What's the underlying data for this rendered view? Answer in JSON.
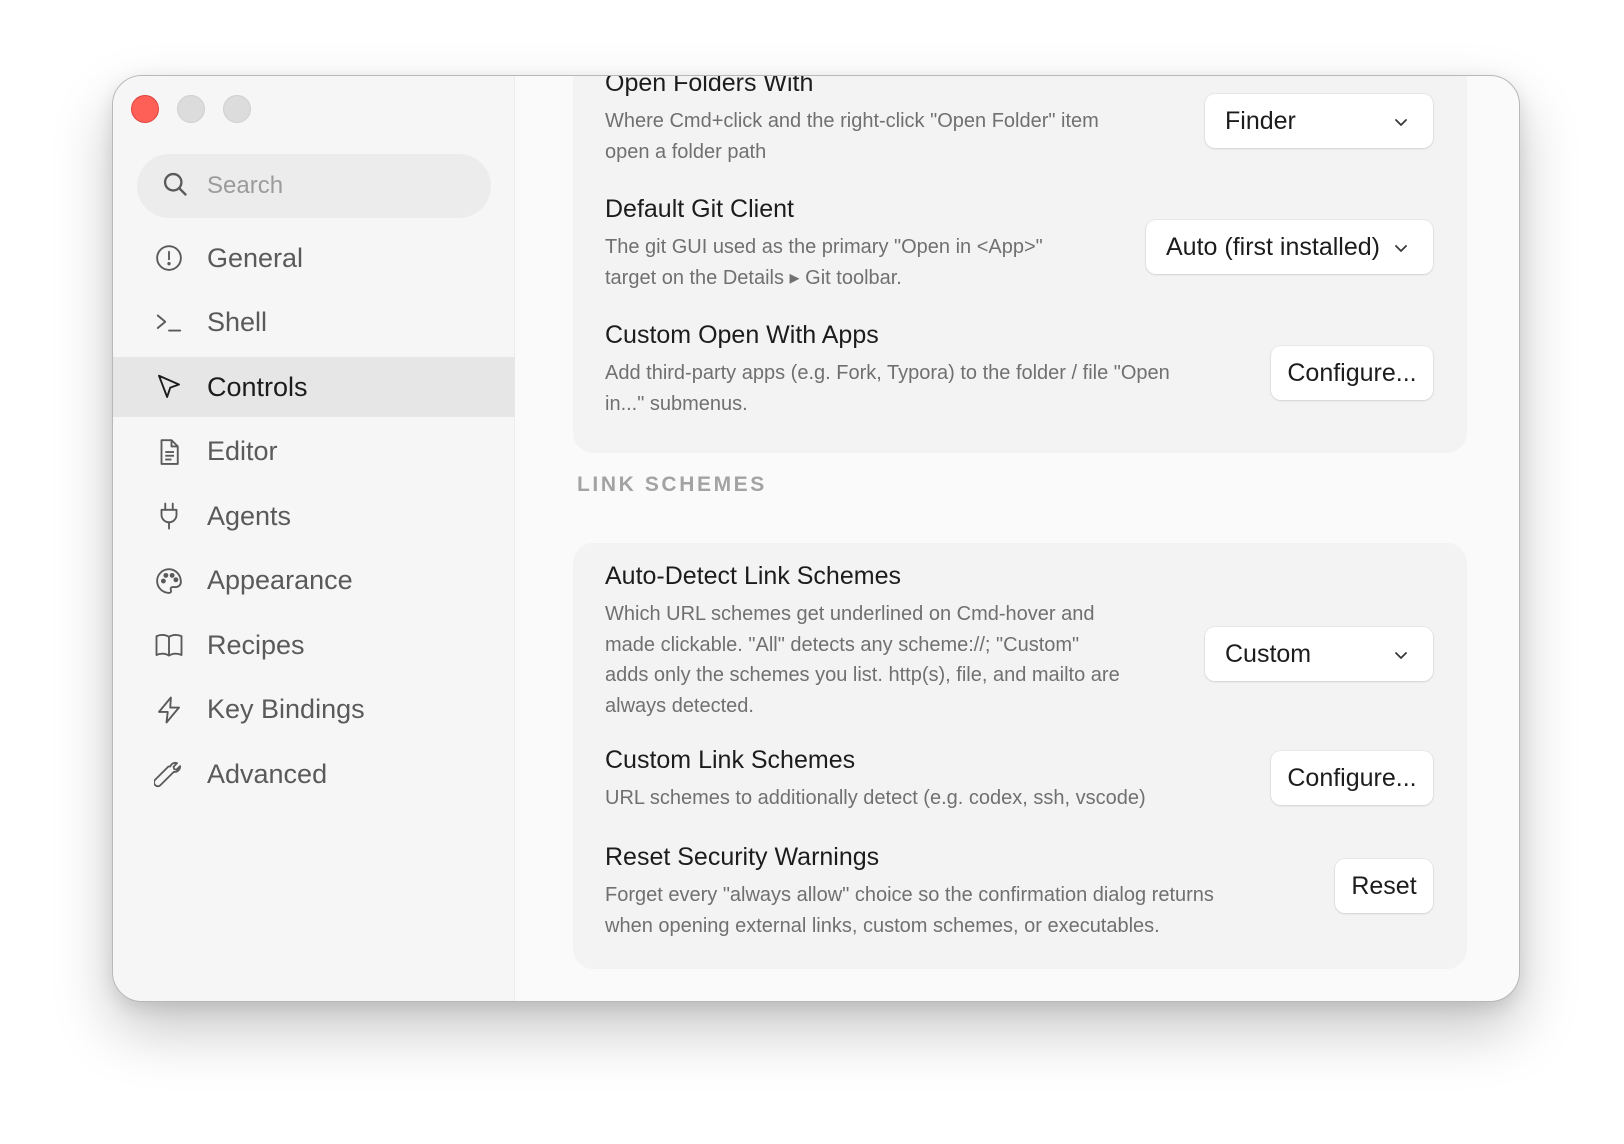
{
  "window": {
    "controls": {
      "close": "close",
      "minimize": "minimize",
      "zoom": "zoom"
    }
  },
  "sidebar": {
    "search": {
      "placeholder": "Search"
    },
    "items": [
      {
        "label": "General",
        "icon": "exclamation-circle-icon",
        "active": false
      },
      {
        "label": "Shell",
        "icon": "terminal-prompt-icon",
        "active": false
      },
      {
        "label": "Controls",
        "icon": "cursor-pointer-icon",
        "active": true
      },
      {
        "label": "Editor",
        "icon": "document-icon",
        "active": false
      },
      {
        "label": "Agents",
        "icon": "plug-icon",
        "active": false
      },
      {
        "label": "Appearance",
        "icon": "palette-icon",
        "active": false
      },
      {
        "label": "Recipes",
        "icon": "book-icon",
        "active": false
      },
      {
        "label": "Key Bindings",
        "icon": "lightning-icon",
        "active": false
      },
      {
        "label": "Advanced",
        "icon": "wrench-icon",
        "active": false
      }
    ]
  },
  "main": {
    "open_with": {
      "folders": {
        "title": "Open Folders With",
        "description_line1": "Where Cmd+click and the right-click \"Open Folder\" item",
        "description_line2": "open a folder path",
        "value": "Finder"
      },
      "git_client": {
        "title": "Default Git Client",
        "description_line1": "The git GUI used as the primary \"Open in <App>\"",
        "description_line2": "target on the Details ▸ Git toolbar.",
        "value": "Auto (first installed)"
      },
      "custom_apps": {
        "title": "Custom Open With Apps",
        "description_line1": "Add third-party apps (e.g. Fork, Typora) to the folder / file \"Open",
        "description_line2": "in...\" submenus.",
        "button": "Configure..."
      }
    },
    "link_schemes": {
      "header": "LINK SCHEMES",
      "auto_detect": {
        "title": "Auto-Detect Link Schemes",
        "description_line1": "Which URL schemes get underlined on Cmd-hover and",
        "description_line2": "made clickable. \"All\" detects any scheme://; \"Custom\"",
        "description_line3": "adds only the schemes you list. http(s), file, and mailto are",
        "description_line4": "always detected.",
        "value": "Custom"
      },
      "custom_schemes": {
        "title": "Custom Link Schemes",
        "description_line1": "URL schemes to additionally detect (e.g. codex, ssh, vscode)",
        "button": "Configure..."
      },
      "reset_warnings": {
        "title": "Reset Security Warnings",
        "description_line1": "Forget every \"always allow\" choice so the confirmation dialog returns",
        "description_line2": "when opening external links, custom schemes, or executables.",
        "button": "Reset"
      }
    }
  },
  "colors": {
    "close": "#fe5f57",
    "inactive_control": "#dcdcdc",
    "sidebar_bg": "#f6f6f6",
    "active_item_bg": "#e6e6e6",
    "card_bg": "#f3f3f3"
  }
}
